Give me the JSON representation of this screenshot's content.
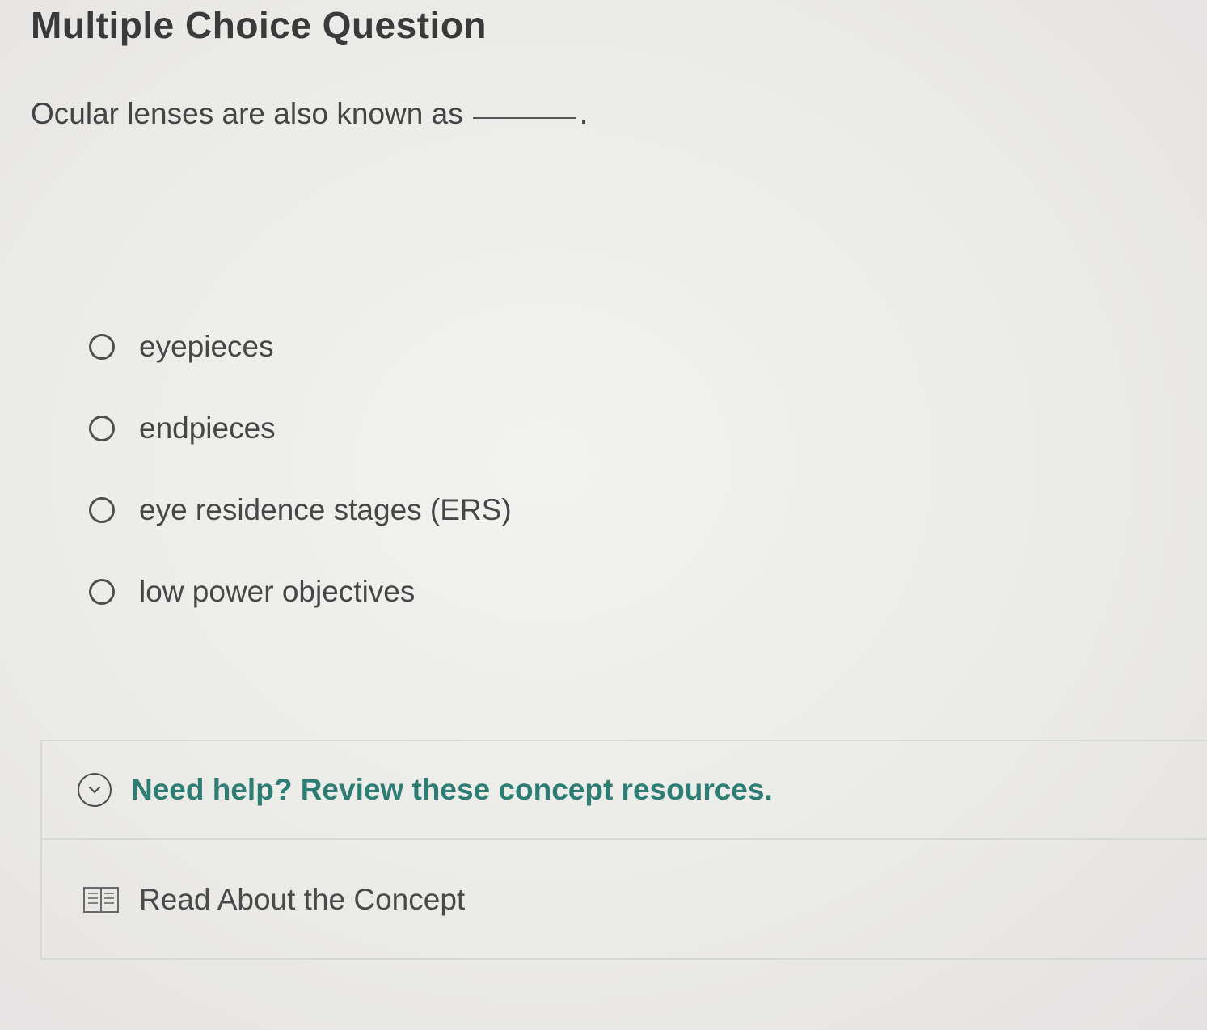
{
  "page_title": "Multiple Choice Question",
  "question": {
    "text": "Ocular lenses are also known as",
    "end_punct": "."
  },
  "options": [
    {
      "label": "eyepieces"
    },
    {
      "label": "endpieces"
    },
    {
      "label": "eye residence stages (ERS)"
    },
    {
      "label": "low power objectives"
    }
  ],
  "help": {
    "title": "Need help? Review these concept resources.",
    "resource_label": "Read About the Concept"
  },
  "colors": {
    "help_title": "#2e7d74",
    "text": "#454545"
  },
  "icons": {
    "help_toggle": "chevron-down-icon",
    "resource": "book-icon"
  }
}
